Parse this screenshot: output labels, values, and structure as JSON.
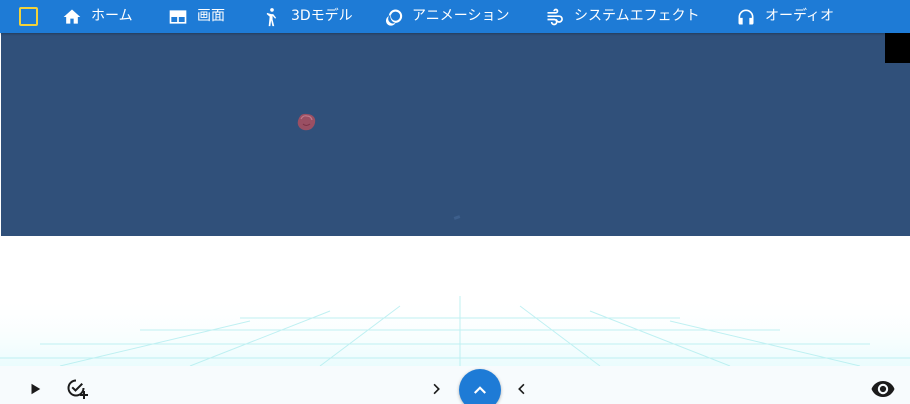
{
  "nav": {
    "items": [
      {
        "label": "ホーム",
        "icon": "home-icon"
      },
      {
        "label": "画面",
        "icon": "screen-layout-icon"
      },
      {
        "label": "3Dモデル",
        "icon": "figure-icon"
      },
      {
        "label": "アニメーション",
        "icon": "rings-icon"
      },
      {
        "label": "システムエフェクト",
        "icon": "wind-icon"
      },
      {
        "label": "オーディオ",
        "icon": "headphones-icon"
      }
    ]
  },
  "colors": {
    "nav_bg": "#1e7bd6",
    "viewport_bg": "#30507a",
    "accent_square": "#f2d23a",
    "fab": "#1e7bd6",
    "grid_lines": "#b6eef0"
  },
  "bottom_toolbar": {
    "icons": [
      "play-icon",
      "check-add-icon",
      "chevron-right-icon",
      "chevron-up-icon",
      "chevron-left-icon",
      "eye-icon"
    ]
  }
}
